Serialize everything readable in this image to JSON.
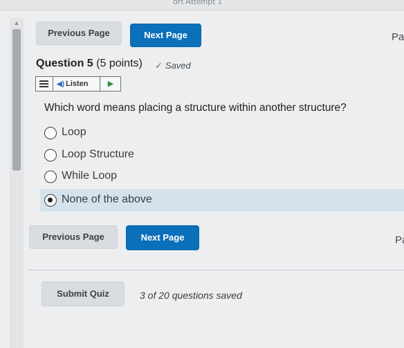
{
  "header": {
    "attempt_text": "ort Attempt 1"
  },
  "nav_top": {
    "previous_label": "Previous Page",
    "next_label": "Next Page",
    "cut_label": "Pa"
  },
  "question": {
    "number_label": "Question 5",
    "points_label": "(5 points)",
    "saved_label": "Saved",
    "listen_label": "Listen",
    "prompt": "Which word means placing a structure within another structure?",
    "options": [
      {
        "label": "Loop",
        "selected": false
      },
      {
        "label": "Loop Structure",
        "selected": false
      },
      {
        "label": "While Loop",
        "selected": false
      },
      {
        "label": "None of the above",
        "selected": true
      }
    ]
  },
  "nav_bottom": {
    "previous_label": "Previous Page",
    "next_label": "Next Page",
    "cut_label": "Pa"
  },
  "footer": {
    "submit_label": "Submit Quiz",
    "status_text": "3 of 20 questions saved"
  },
  "colors": {
    "primary": "#0b6fba",
    "selected_row": "#d4e2ec",
    "background": "#eceef0"
  },
  "icons": [
    "scroll-up-arrow-icon",
    "checkmark-icon",
    "hamburger-menu-icon",
    "speaker-icon",
    "play-icon",
    "radio-icon"
  ]
}
